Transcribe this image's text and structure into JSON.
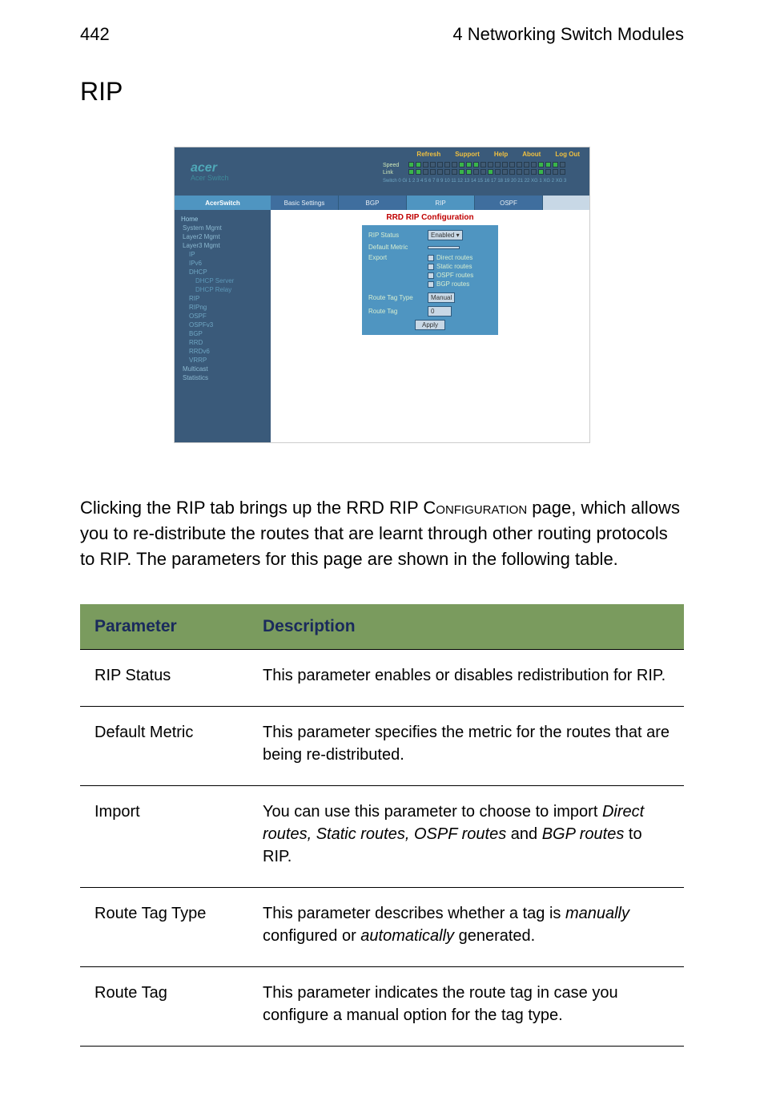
{
  "page": {
    "number": "442",
    "chapter": "4 Networking Switch Modules"
  },
  "heading": "RIP",
  "screenshot": {
    "top_links": [
      "Refresh",
      "Support",
      "Help",
      "About",
      "Log Out"
    ],
    "logo": "acer",
    "logo_sub": "Acer Switch",
    "port_rows": {
      "speed": "Speed",
      "link": "Link",
      "switch_row": "Switch 0 Gi 1 2 3 4 5 6 7 8 9 10 11 12 13 14 15 16 17 18 19 20 21 22 XG 1 XG 2 XG 3"
    },
    "brand_tab": "AcerSwitch",
    "tabs": [
      "Basic Settings",
      "BGP",
      "RIP",
      "OSPF"
    ],
    "sidebar": {
      "home": "Home",
      "items": [
        "System Mgmt",
        "Layer2 Mgmt",
        "Layer3 Mgmt",
        "IP",
        "IPv6",
        "DHCP",
        "DHCP Server",
        "DHCP Relay",
        "RIP",
        "RIPng",
        "OSPF",
        "OSPFv3",
        "BGP",
        "RRD",
        "RRDv6",
        "VRRP",
        "Multicast",
        "Statistics"
      ]
    },
    "config_title": "RRD RIP Configuration",
    "form": {
      "rip_status_label": "RIP Status",
      "rip_status_value": "Enabled",
      "default_metric_label": "Default Metric",
      "default_metric_value": "",
      "export_label": "Export",
      "export_options": [
        "Direct routes",
        "Static routes",
        "OSPF routes",
        "BGP routes"
      ],
      "route_tag_type_label": "Route Tag Type",
      "route_tag_type_value": "Manual",
      "route_tag_label": "Route Tag",
      "route_tag_value": "0",
      "apply": "Apply"
    }
  },
  "body_text": {
    "p1a": "Clicking the RIP tab brings up the RRD RIP C",
    "p1sc": "onfiguration",
    "p1b": " page, which allows you to re-distribute the routes that are learnt through other routing protocols to RIP. The parameters for this page are shown in the following table."
  },
  "table": {
    "headers": {
      "param": "Parameter",
      "desc": "Description"
    },
    "rows": [
      {
        "param": "RIP Status",
        "desc": "This parameter enables or disables redistribution for RIP."
      },
      {
        "param": "Default Metric",
        "desc": "This parameter specifies the metric for the routes that are being re-distributed."
      },
      {
        "param": "Import",
        "desc_pre": "You can use this parameter to choose to import ",
        "em1": "Direct routes, Static routes, OSPF routes",
        "mid": " and ",
        "em2": "BGP routes",
        "post": " to RIP."
      },
      {
        "param": "Route Tag Type",
        "desc_pre": "This parameter describes whether a tag is ",
        "em1": "manually",
        "mid": " configured or ",
        "em2": "automatically",
        "post": " generated."
      },
      {
        "param": "Route Tag",
        "desc": "This parameter indicates the route tag in case you configure a manual option for the tag type."
      }
    ]
  }
}
